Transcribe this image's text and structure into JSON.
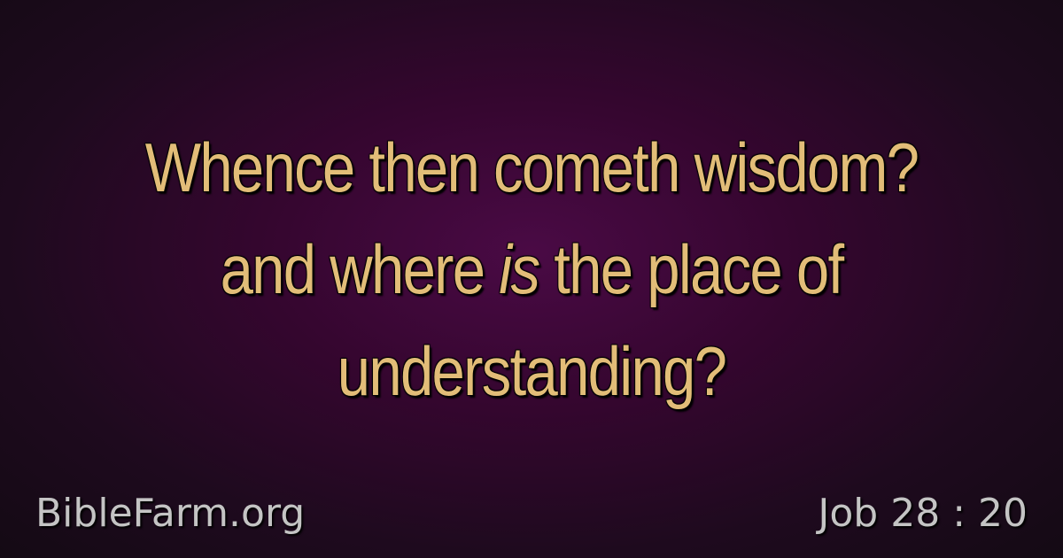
{
  "verse": {
    "line1": "Whence then cometh wisdom?",
    "line2_before": "and where ",
    "line2_italic": "is",
    "line2_after": " the place of",
    "line3": "understanding?"
  },
  "footer": {
    "site": "BibleFarm.org",
    "reference": "Job 28 : 20"
  },
  "colors": {
    "verse_text": "#e2bd78",
    "footer_text": "#c4c4c4",
    "background_center": "#4a0a45",
    "background_edge": "#140a14"
  }
}
